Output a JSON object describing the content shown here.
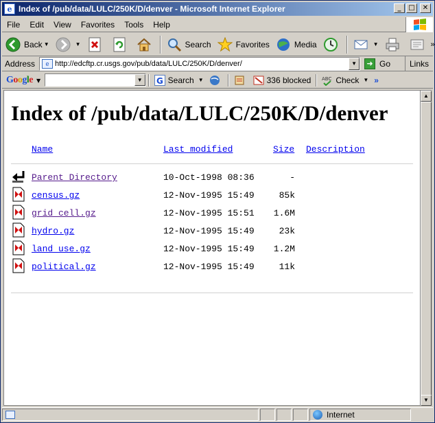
{
  "window": {
    "title": "Index of /pub/data/LULC/250K/D/denver - Microsoft Internet Explorer",
    "controls": {
      "minimize": "_",
      "maximize": "□",
      "close": "✕"
    }
  },
  "menu": [
    "File",
    "Edit",
    "View",
    "Favorites",
    "Tools",
    "Help"
  ],
  "toolbar": {
    "back": "Back",
    "search": "Search",
    "favorites": "Favorites",
    "media": "Media"
  },
  "address": {
    "label": "Address",
    "url": "http://edcftp.cr.usgs.gov/pub/data/LULC/250K/D/denver/",
    "go": "Go",
    "links": "Links"
  },
  "google_bar": {
    "search_value": "",
    "search_label": "Search",
    "blocked": "336 blocked",
    "check": "Check",
    "more": "»"
  },
  "page": {
    "heading": "Index of /pub/data/LULC/250K/D/denver",
    "columns": {
      "name": "Name",
      "modified": "Last modified",
      "size": "Size",
      "description": "Description"
    },
    "entries": [
      {
        "name": "Parent Directory",
        "modified": "10-Oct-1998 08:36",
        "size": "-",
        "type": "parent"
      },
      {
        "name": "census.gz",
        "modified": "12-Nov-1995 15:49",
        "size": "85k",
        "type": "file"
      },
      {
        "name": "grid_cell.gz",
        "modified": "12-Nov-1995 15:51",
        "size": "1.6M",
        "type": "file"
      },
      {
        "name": "hydro.gz",
        "modified": "12-Nov-1995 15:49",
        "size": "23k",
        "type": "file"
      },
      {
        "name": "land_use.gz",
        "modified": "12-Nov-1995 15:49",
        "size": "1.2M",
        "type": "file"
      },
      {
        "name": "political.gz",
        "modified": "12-Nov-1995 15:49",
        "size": "11k",
        "type": "file"
      }
    ]
  },
  "status": {
    "message": "",
    "zone": "Internet"
  }
}
